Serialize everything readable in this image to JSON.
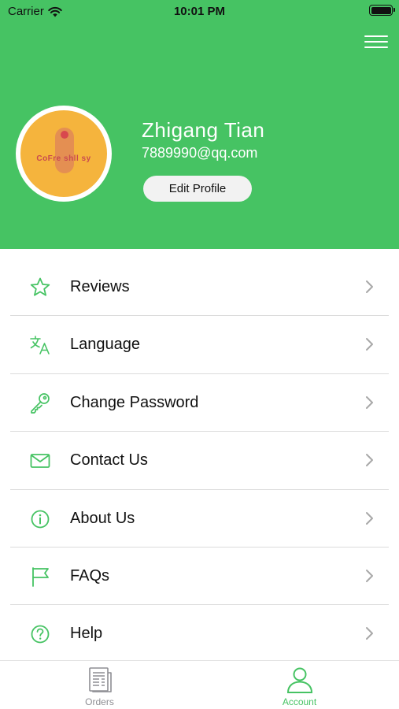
{
  "status_bar": {
    "carrier": "Carrier",
    "time": "10:01 PM"
  },
  "profile": {
    "name": "Zhigang Tian",
    "email": "7889990@qq.com",
    "edit_button": "Edit Profile",
    "avatar_text": "CoFre shll sy"
  },
  "menu": [
    {
      "label": "Reviews",
      "icon": "star-icon"
    },
    {
      "label": "Language",
      "icon": "translate-icon"
    },
    {
      "label": "Change Password",
      "icon": "key-icon"
    },
    {
      "label": "Contact Us",
      "icon": "mail-icon"
    },
    {
      "label": "About Us",
      "icon": "info-icon"
    },
    {
      "label": "FAQs",
      "icon": "flag-icon"
    },
    {
      "label": "Help",
      "icon": "question-icon"
    }
  ],
  "tabs": [
    {
      "label": "Orders",
      "icon": "orders-icon",
      "active": false
    },
    {
      "label": "Account",
      "icon": "account-icon",
      "active": true
    }
  ],
  "colors": {
    "brand": "#46c363",
    "icon_green": "#46c363",
    "tab_inactive": "#8e8e93",
    "divider": "#dcdcdc"
  }
}
